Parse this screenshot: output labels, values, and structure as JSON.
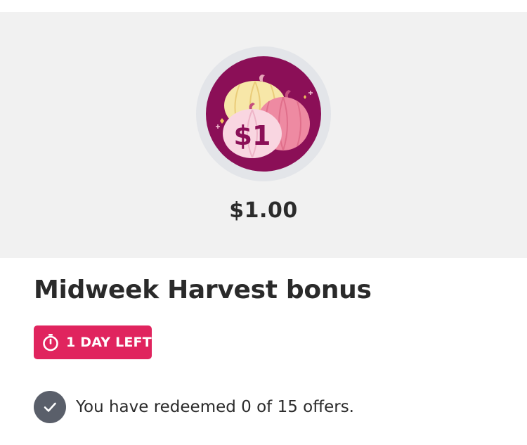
{
  "offer": {
    "badge_text": "$1",
    "amount": "$1.00",
    "title": "Midweek Harvest bonus",
    "time_left": "1 DAY LEFT",
    "redeemed_text": "You have redeemed 0 of 15 offers."
  },
  "icons": {
    "badge": "pumpkin-badge-icon",
    "timer": "stopwatch-icon",
    "status": "checkmark-icon"
  },
  "colors": {
    "hero_background": "#f1f1f1",
    "badge_background": "#8b0f57",
    "time_pill": "#e0245e",
    "check_circle": "#5a5f6a"
  }
}
